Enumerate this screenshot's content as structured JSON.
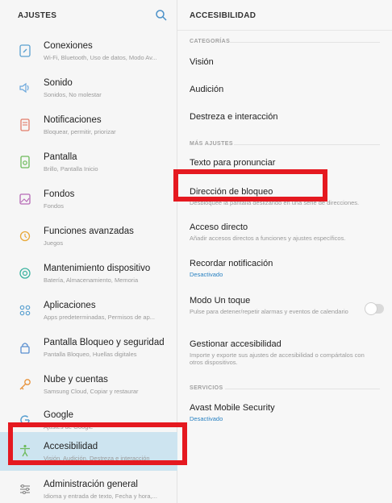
{
  "left_panel": {
    "title": "AJUSTES",
    "items": [
      {
        "title": "Conexiones",
        "subtitle": "Wi-Fi, Bluetooth, Uso de datos, Modo Av...",
        "icon": "connections-icon"
      },
      {
        "title": "Sonido",
        "subtitle": "Sonidos, No molestar",
        "icon": "sound-icon"
      },
      {
        "title": "Notificaciones",
        "subtitle": "Bloquear, permitir, priorizar",
        "icon": "notifications-icon"
      },
      {
        "title": "Pantalla",
        "subtitle": "Brillo, Pantalla Inicio",
        "icon": "display-icon"
      },
      {
        "title": "Fondos",
        "subtitle": "Fondos",
        "icon": "wallpaper-icon"
      },
      {
        "title": "Funciones avanzadas",
        "subtitle": "Juegos",
        "icon": "advanced-features-icon"
      },
      {
        "title": "Mantenimiento dispositivo",
        "subtitle": "Batería, Almacenamiento, Memoria",
        "icon": "device-maintenance-icon"
      },
      {
        "title": "Aplicaciones",
        "subtitle": "Apps predeterminadas, Permisos de ap...",
        "icon": "apps-icon"
      },
      {
        "title": "Pantalla Bloqueo y seguridad",
        "subtitle": "Pantalla Bloqueo, Huellas digitales",
        "icon": "lock-icon"
      },
      {
        "title": "Nube y cuentas",
        "subtitle": "Samsung Cloud, Copiar y restaurar",
        "icon": "key-icon"
      },
      {
        "title": "Google",
        "subtitle": "Ajustes de Google",
        "icon": "google-icon"
      },
      {
        "title": "Accesibilidad",
        "subtitle": "Visión, Audición, Destreza e interacción",
        "icon": "accessibility-icon"
      },
      {
        "title": "Administración general",
        "subtitle": "Idioma y entrada de texto, Fecha y hora,...",
        "icon": "general-management-icon"
      }
    ]
  },
  "right_panel": {
    "title": "ACCESIBILIDAD",
    "sections": {
      "categorias": "CATEGORÍAS",
      "mas_ajustes": "MÁS AJUSTES",
      "servicios": "SERVICIOS"
    },
    "items": {
      "vision": {
        "title": "Visión"
      },
      "audicion": {
        "title": "Audición"
      },
      "destreza": {
        "title": "Destreza e interacción"
      },
      "texto_pronunciar": {
        "title": "Texto para pronunciar"
      },
      "direccion_bloqueo": {
        "title": "Dirección de bloqueo",
        "subtitle": "Desbloquee la pantalla deslizando en una serie de direcciones."
      },
      "acceso_directo": {
        "title": "Acceso directo",
        "subtitle": "Añadir accesos directos a funciones y ajustes específicos."
      },
      "recordar_notificacion": {
        "title": "Recordar notificación",
        "subtitle": "Desactivado"
      },
      "modo_un_toque": {
        "title": "Modo Un toque",
        "subtitle": "Pulse para detener/repetir alarmas y eventos de calendario"
      },
      "gestionar": {
        "title": "Gestionar accesibilidad",
        "subtitle": "Importe y exporte sus ajustes de accesibilidad o compártalos con otros dispositivos."
      },
      "avast": {
        "title": "Avast Mobile Security",
        "subtitle": "Desactivado"
      }
    }
  },
  "colors": {
    "highlight": "#e51920",
    "active_row": "#cde4f0",
    "link_blue": "#2a82c2"
  }
}
